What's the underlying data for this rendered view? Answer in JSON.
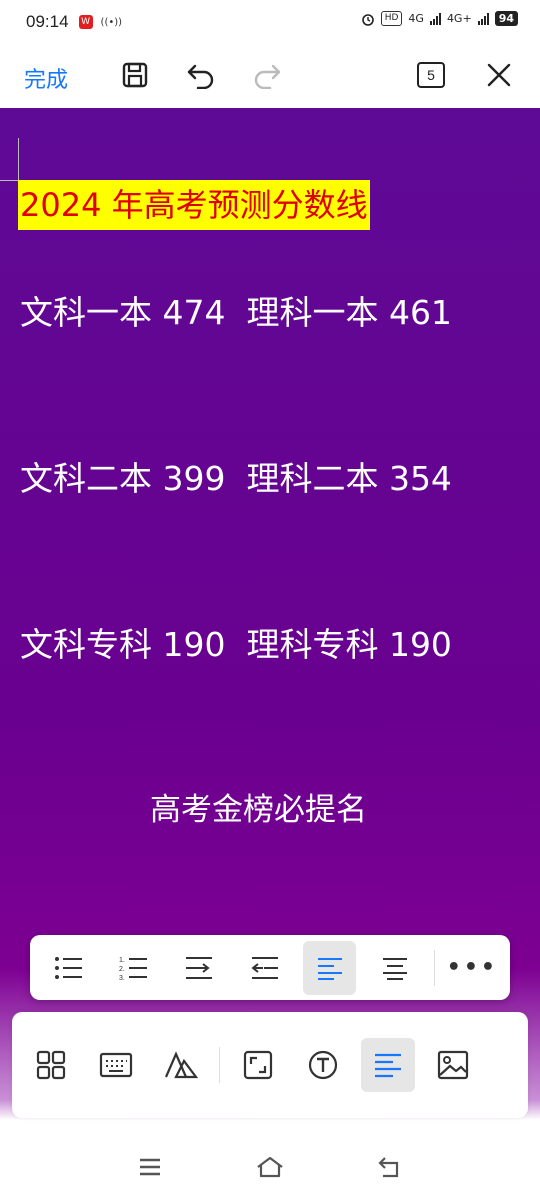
{
  "status_bar": {
    "time": "09:14",
    "app_badge": "W",
    "network_hd": "HD",
    "network_4g_1": "4G",
    "network_4g_2": "4G+",
    "battery": "94",
    "icons": [
      "alarm-icon",
      "signal-icon",
      "battery-icon"
    ]
  },
  "toolbar": {
    "done_label": "完成",
    "page_count": "5",
    "icons": [
      "save-icon",
      "undo-icon",
      "redo-icon",
      "close-icon"
    ]
  },
  "document": {
    "title": "2024 年高考预测分数线",
    "lines": [
      "文科一本 474  理科一本 461",
      "文科二本 399  理科二本 354",
      "文科专科 190  理科专科 190"
    ],
    "slogan": "高考金榜必提名",
    "colors": {
      "background": "#6a0090",
      "title_bg": "#ffff00",
      "title_text": "#e00000",
      "body_text": "#ffffff"
    }
  },
  "format_bar": {
    "buttons": [
      "bullet-list-icon",
      "numbered-list-icon",
      "indent-increase-icon",
      "indent-decrease-icon",
      "align-left-icon",
      "align-center-icon",
      "more-icon"
    ],
    "active": "align-left-icon",
    "more_label": "•••"
  },
  "tool_panel": {
    "buttons": [
      "components-icon",
      "keyboard-icon",
      "text-style-icon",
      "resize-icon",
      "text-box-icon",
      "paragraph-align-icon",
      "image-icon"
    ],
    "active": "paragraph-align-icon",
    "accent": "#1677ff"
  },
  "nav_bar": {
    "buttons": [
      "menu-icon",
      "home-icon",
      "back-icon"
    ]
  }
}
